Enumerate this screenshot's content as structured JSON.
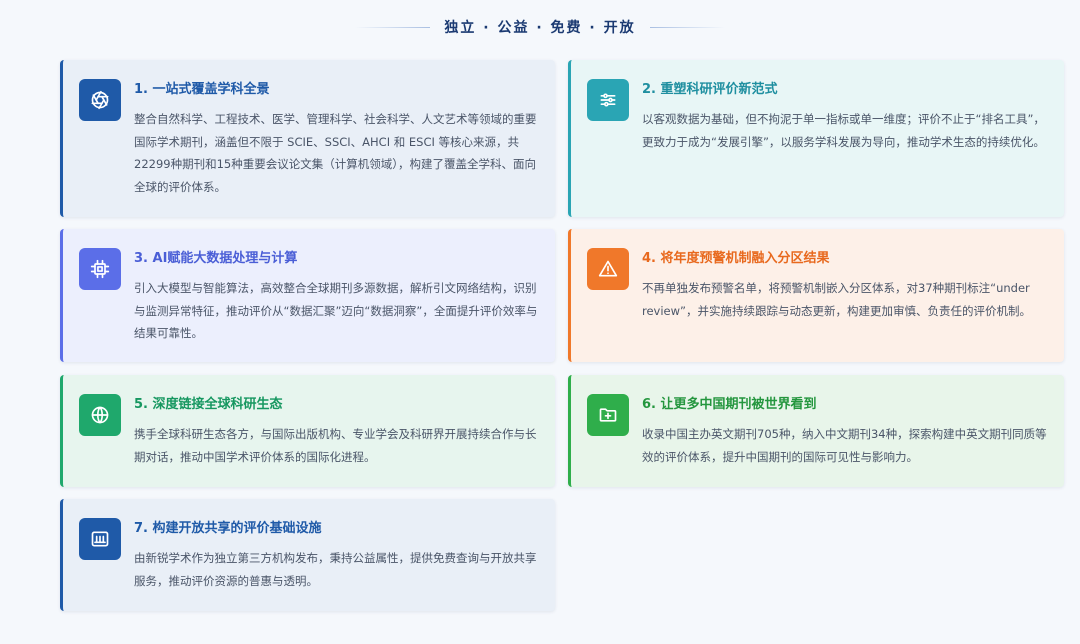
{
  "header": {
    "title": "独立 · 公益 · 免费 · 开放"
  },
  "cards": [
    {
      "title": "1. 一站式覆盖学科全景",
      "desc": "整合自然科学、工程技术、医学、管理科学、社会科学、人文艺术等领域的重要国际学术期刊，涵盖但不限于 SCIE、SSCI、AHCI 和 ESCI 等核心来源，共22299种期刊和15种重要会议论文集（计算机领域），构建了覆盖全学科、面向全球的评价体系。",
      "icon": "aperture-icon",
      "accent": "#1f5aa8"
    },
    {
      "title": "2. 重塑科研评价新范式",
      "desc": "以客观数据为基础，但不拘泥于单一指标或单一维度；评价不止于“排名工具”，更致力于成为“发展引擎”，以服务学科发展为导向，推动学术生态的持续优化。",
      "icon": "sliders-icon",
      "accent": "#2aa5b4"
    },
    {
      "title": "3. AI赋能大数据处理与计算",
      "desc": "引入大模型与智能算法，高效整合全球期刊多源数据，解析引文网络结构，识别与监测异常特征，推动评价从“数据汇聚”迈向“数据洞察”，全面提升评价效率与结果可靠性。",
      "icon": "cpu-icon",
      "accent": "#5b6ee8"
    },
    {
      "title": "4. 将年度预警机制融入分区结果",
      "desc": "不再单独发布预警名单，将预警机制嵌入分区体系，对37种期刊标注“under review”，并实施持续跟踪与动态更新，构建更加审慎、负责任的评价机制。",
      "icon": "warning-icon",
      "accent": "#f0782a"
    },
    {
      "title": "5. 深度链接全球科研生态",
      "desc": "携手全球科研生态各方，与国际出版机构、专业学会及科研界开展持续合作与长期对话，推动中国学术评价体系的国际化进程。",
      "icon": "globe-icon",
      "accent": "#1fa86c"
    },
    {
      "title": "6. 让更多中国期刊被世界看到",
      "desc": "收录中国主办英文期刊705种，纳入中文期刊34种，探索构建中英文期刊同质等效的评价体系，提升中国期刊的国际可见性与影响力。",
      "icon": "folder-plus-icon",
      "accent": "#2fae4b"
    },
    {
      "title": "7. 构建开放共享的评价基础设施",
      "desc": "由新锐学术作为独立第三方机构发布，秉持公益属性，提供免费查询与开放共享服务，推动评价资源的普惠与透明。",
      "icon": "library-icon",
      "accent": "#1f5aa8"
    }
  ]
}
